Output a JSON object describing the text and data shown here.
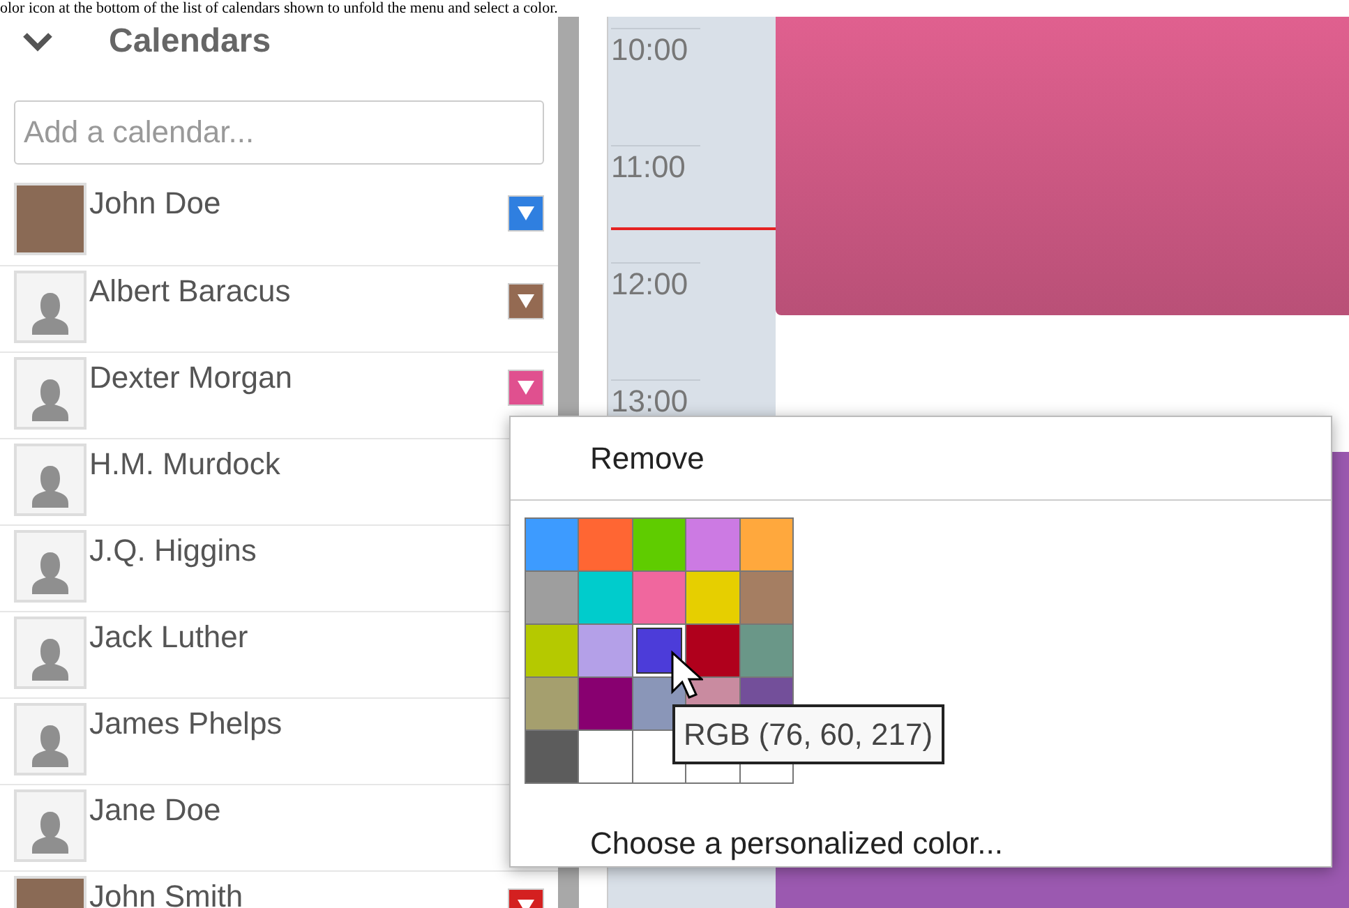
{
  "caption": "olor icon at the bottom of the list of calendars shown to unfold the menu and select a color.",
  "sidebar": {
    "title": "Calendars",
    "expanded": true,
    "search": {
      "placeholder": "Add a calendar..."
    },
    "calendars": [
      {
        "name": "John Doe",
        "kind": "photo",
        "color": "#2f7fe0"
      },
      {
        "name": "Albert Baracus",
        "kind": "generic",
        "color": "#946a52"
      },
      {
        "name": "Dexter Morgan",
        "kind": "generic",
        "color": "#e0508f"
      },
      {
        "name": "H.M. Murdock",
        "kind": "generic"
      },
      {
        "name": "J.Q. Higgins",
        "kind": "generic"
      },
      {
        "name": "Jack Luther",
        "kind": "generic"
      },
      {
        "name": "James Phelps",
        "kind": "generic"
      },
      {
        "name": "Jane Doe",
        "kind": "generic"
      },
      {
        "name": "John Smith",
        "kind": "photo",
        "color": "#d42020"
      }
    ]
  },
  "calendar": {
    "hours": [
      "10:00",
      "11:00",
      "12:00",
      "13:00"
    ]
  },
  "menu": {
    "items": [
      "Remove"
    ],
    "palette": [
      {
        "color": "#3d9bff",
        "selected": false
      },
      {
        "color": "#ff6633",
        "selected": false
      },
      {
        "color": "#5fcc00",
        "selected": false
      },
      {
        "color": "#cc7ae3",
        "selected": false
      },
      {
        "color": "#ffa83d",
        "selected": false
      },
      {
        "color": "#9e9e9e",
        "selected": false
      },
      {
        "color": "#00cccc",
        "selected": false
      },
      {
        "color": "#f0679e",
        "selected": false
      },
      {
        "color": "#e6cf00",
        "selected": false
      },
      {
        "color": "#a57e62",
        "selected": false
      },
      {
        "color": "#b5c900",
        "selected": false
      },
      {
        "color": "#b4a0e8",
        "selected": false
      },
      {
        "color": "#4c3cd9",
        "selected": true
      },
      {
        "color": "#b0001c",
        "selected": false
      },
      {
        "color": "#6a9788",
        "selected": false
      },
      {
        "color": "#a59f6e",
        "selected": false
      },
      {
        "color": "#880070",
        "selected": false
      },
      {
        "color": "#8a96b8",
        "selected": false
      },
      {
        "color": "#c98ba0",
        "selected": false
      },
      {
        "color": "#734f9a",
        "selected": false
      },
      {
        "color": "#5c5c5c",
        "selected": false
      },
      {
        "color": "#ffffff",
        "selected": false
      },
      {
        "color": "#ffffff",
        "selected": false
      },
      {
        "color": "#ffffff",
        "selected": false
      },
      {
        "color": "#ffffff",
        "selected": false
      }
    ],
    "tooltip": "RGB (76, 60, 217)",
    "custom_color": "Choose a personalized color..."
  }
}
